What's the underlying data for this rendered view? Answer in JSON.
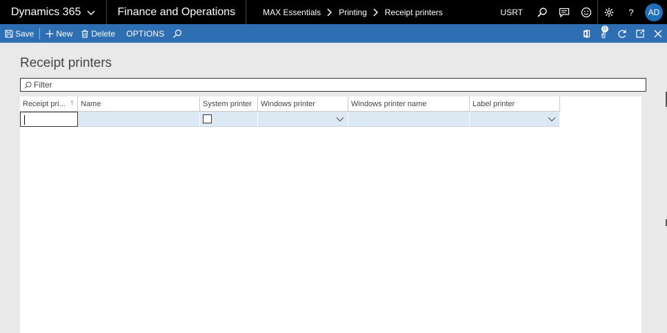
{
  "header": {
    "brand": "Dynamics 365",
    "app_name": "Finance and Operations",
    "breadcrumb": [
      "MAX Essentials",
      "Printing",
      "Receipt printers"
    ],
    "company": "USRT",
    "user_initials": "AD"
  },
  "actionbar": {
    "save_label": "Save",
    "new_label": "New",
    "delete_label": "Delete",
    "options_label": "OPTIONS",
    "notification_count": "0"
  },
  "page": {
    "title": "Receipt printers",
    "filter_placeholder": "Filter"
  },
  "grid": {
    "columns": [
      "Receipt pri...",
      "Name",
      "System printer",
      "Windows printer",
      "Windows printer name",
      "Label printer"
    ],
    "sort_indicator": "↑",
    "rows": [
      {
        "receipt_printer": "",
        "name": "",
        "system_printer": false,
        "windows_printer": "",
        "windows_printer_name": "",
        "label_printer": ""
      }
    ]
  },
  "colors": {
    "topbar": "#000000",
    "actionbar": "#2e6fb3",
    "avatar": "#1f6fba",
    "row_selected": "#dde8f5"
  }
}
